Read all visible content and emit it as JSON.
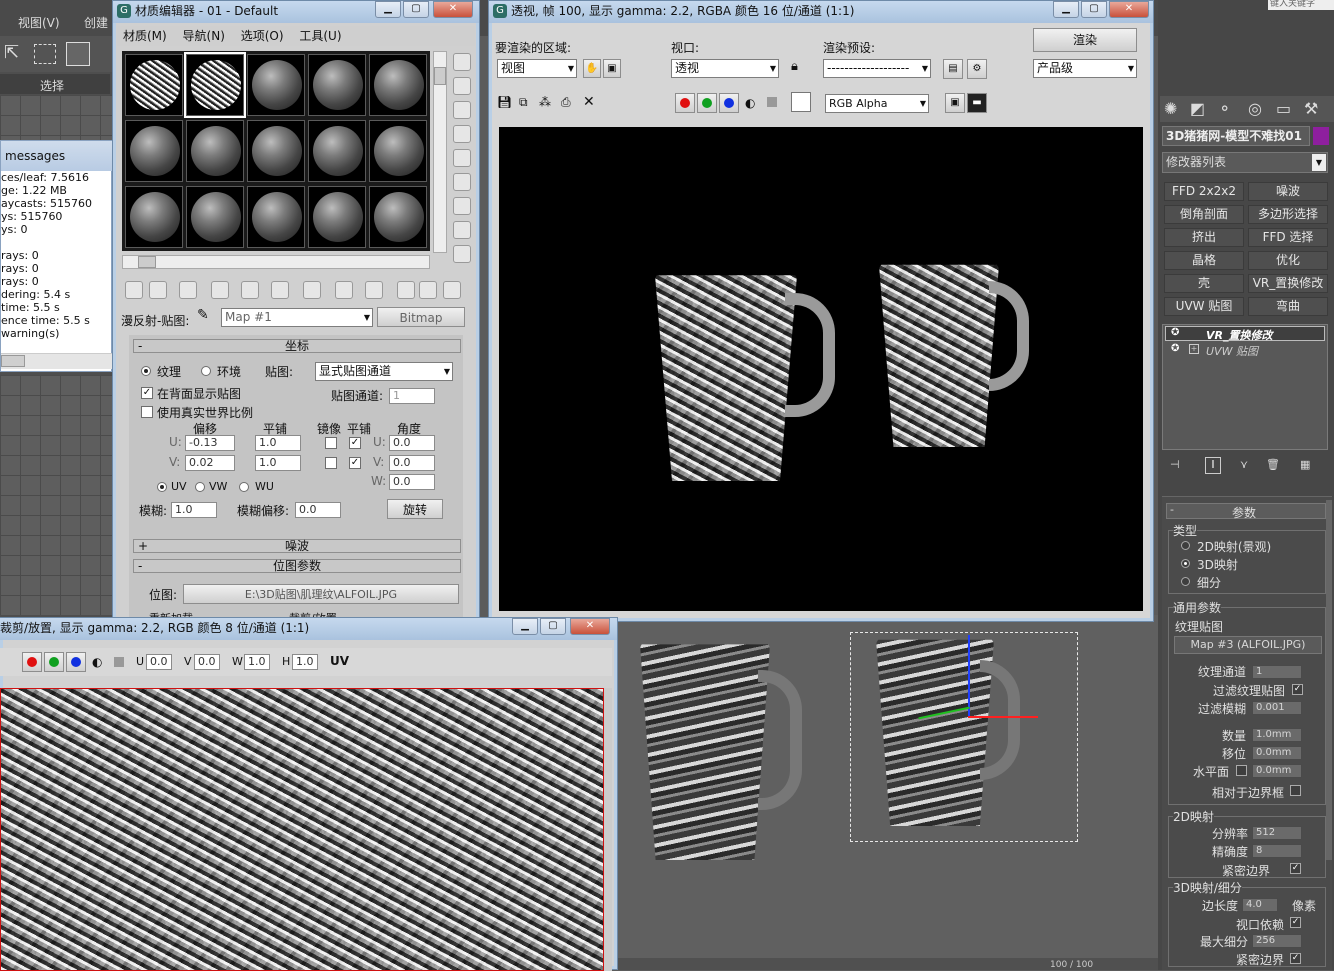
{
  "main_app": {
    "menu_view": "视图(V)",
    "menu_create": "创建",
    "select_label": "选择",
    "search_placeholder": "键入关键字"
  },
  "messages": {
    "title": "messages",
    "lines": [
      "ces/leaf: 7.5616",
      "ge: 1.22 MB",
      "aycasts: 515760",
      "ys: 515760",
      "ys: 0",
      "",
      "rays: 0",
      " rays: 0",
      " rays: 0",
      "dering: 5.4 s",
      "time: 5.5 s",
      "ence time: 5.5 s",
      "warning(s)"
    ]
  },
  "material_editor": {
    "title": "材质编辑器 - 01 - Default",
    "menu": [
      "材质(M)",
      "导航(N)",
      "选项(O)",
      "工具(U)"
    ],
    "map_label": "漫反射-贴图:",
    "map_name": "Map #1",
    "map_type": "Bitmap",
    "coords_title": "坐标",
    "texture_radio": "纹理",
    "env_radio": "环境",
    "mapping_label": "贴图:",
    "mapping_value": "显式贴图通道",
    "show_back": "在背面显示贴图",
    "map_channel_label": "贴图通道:",
    "map_channel_value": "1",
    "real_world": "使用真实世界比例",
    "offset_h": "偏移",
    "tiling_h": "平铺",
    "mirror_h": "镜像",
    "tile_h": "平铺",
    "angle_h": "角度",
    "u_label": "U:",
    "v_label": "V:",
    "w_label": "W:",
    "u_offset": "-0.13",
    "v_offset": "0.02",
    "u_tiling": "1.0",
    "v_tiling": "1.0",
    "u_angle": "0.0",
    "v_angle": "0.0",
    "w_angle": "0.0",
    "uv": "UV",
    "vw": "VW",
    "wu": "WU",
    "blur_label": "模糊:",
    "blur_value": "1.0",
    "blur_offset_label": "模糊偏移:",
    "blur_offset_value": "0.0",
    "rotate_btn": "旋转",
    "noise_title": "噪波",
    "bitmap_params_title": "位图参数",
    "bitmap_label": "位图:",
    "bitmap_path": "E:\\3D贴图\\肌理纹\\ALFOIL.JPG",
    "reload_label": "重新加载",
    "view_image_label": "裁剪/放置"
  },
  "render_window": {
    "title": "透视, 帧 100, 显示 gamma: 2.2, RGBA 颜色 16 位/通道 (1:1)",
    "area_label": "要渲染的区域:",
    "area_value": "视图",
    "viewport_label": "视口:",
    "viewport_value": "透视",
    "preset_label": "渲染预设:",
    "preset_value": "-------------------",
    "render_btn": "渲染",
    "quality_value": "产品级",
    "channel_value": "RGB Alpha"
  },
  "bitmap_window": {
    "title": "裁剪/放置, 显示 gamma: 2.2, RGB 颜色 8 位/通道 (1:1)",
    "u_label": "U",
    "v_label": "V",
    "w_label": "W",
    "h_label": "H",
    "u_value": "0.0",
    "v_value": "0.0",
    "w_value": "1.0",
    "h_value": "1.0",
    "uv_label": "UV"
  },
  "command_panel": {
    "object_name": "3D猪猪网-模型不难找01",
    "modifier_list": "修改器列表",
    "buttons": [
      "FFD 2x2x2",
      "噪波",
      "倒角剖面",
      "多边形选择",
      "挤出",
      "FFD 选择",
      "晶格",
      "优化",
      "壳",
      "VR_置换修改",
      "UVW 贴图",
      "弯曲"
    ],
    "stack": [
      "VR_置换修改",
      "UVW 贴图"
    ],
    "params_title": "参数",
    "type_label": "类型",
    "type_2d": "2D映射(景观)",
    "type_3d": "3D映射",
    "type_sub": "细分",
    "common_label": "通用参数",
    "tex_map_label": "纹理贴图",
    "map_btn": "Map #3 (ALFOIL.JPG)",
    "tex_channel_label": "纹理通道",
    "tex_channel_value": "1",
    "filter_label": "过滤纹理贴图",
    "filter_blur_label": "过滤模糊",
    "filter_blur_value": "0.001",
    "amount_label": "数量",
    "amount_value": "1.0mm",
    "shift_label": "移位",
    "shift_value": "0.0mm",
    "water_label": "水平面",
    "water_value": "0.0mm",
    "relative_label": "相对于边界框",
    "map2d_label": "2D映射",
    "resolution_label": "分辨率",
    "resolution_value": "512",
    "precision_label": "精确度",
    "precision_value": "8",
    "tight_label": "紧密边界",
    "map3d_label": "3D映射/细分",
    "edge_label": "边长度",
    "edge_value": "4.0",
    "pixels_label": "像素",
    "view_dep_label": "视口依赖",
    "max_sub_label": "最大细分",
    "max_sub_value": "256",
    "tight2_label": "紧密边界",
    "frame_counter": "100 / 100"
  },
  "colors": {
    "accent": "#8e1f9e",
    "swatch_red": "#e01010",
    "swatch_green": "#10a020",
    "swatch_blue": "#1030e0"
  }
}
